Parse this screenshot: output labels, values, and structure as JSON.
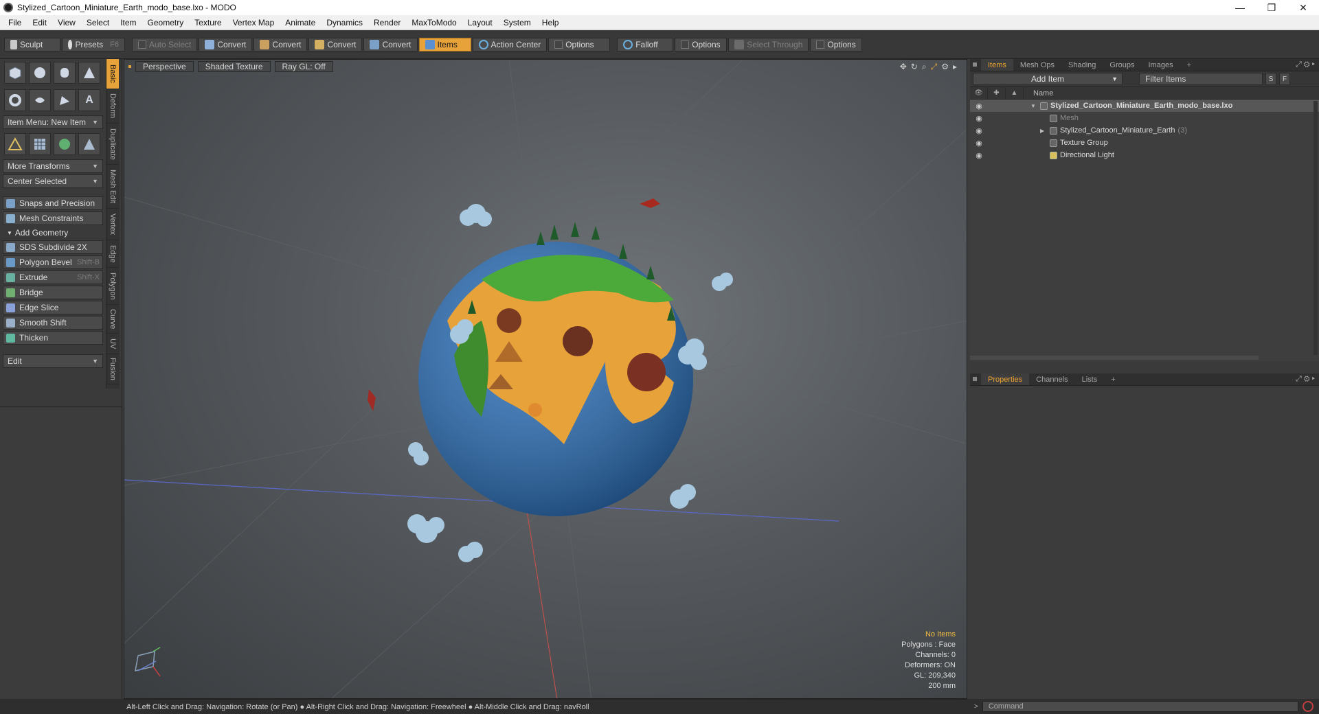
{
  "window": {
    "title": "Stylized_Cartoon_Miniature_Earth_modo_base.lxo - MODO",
    "minimize": "—",
    "restore": "❐",
    "close": "✕"
  },
  "menu": [
    "File",
    "Edit",
    "View",
    "Select",
    "Item",
    "Geometry",
    "Texture",
    "Vertex Map",
    "Animate",
    "Dynamics",
    "Render",
    "MaxToModo",
    "Layout",
    "System",
    "Help"
  ],
  "toolbar": {
    "sculpt": "Sculpt",
    "presets": "Presets",
    "presets_key": "F6",
    "auto_select": "Auto Select",
    "convert": "Convert",
    "items": "Items",
    "action_center": "Action Center",
    "options": "Options",
    "falloff": "Falloff",
    "select_through": "Select Through"
  },
  "left": {
    "item_menu": "Item Menu: New Item",
    "more_transforms": "More Transforms",
    "center_selected": "Center Selected",
    "snaps": "Snaps and Precision",
    "mesh_constraints": "Mesh Constraints",
    "add_geometry": "Add Geometry",
    "tools": [
      {
        "label": "SDS Subdivide 2X",
        "key": ""
      },
      {
        "label": "Polygon Bevel",
        "key": "Shift-B"
      },
      {
        "label": "Extrude",
        "key": "Shift-X"
      },
      {
        "label": "Bridge",
        "key": ""
      },
      {
        "label": "Edge Slice",
        "key": ""
      },
      {
        "label": "Smooth Shift",
        "key": ""
      },
      {
        "label": "Thicken",
        "key": ""
      }
    ],
    "edit": "Edit",
    "vtabs": [
      "Basic",
      "Deform",
      "Duplicate",
      "Mesh Edit",
      "Vertex",
      "Edge",
      "Polygon",
      "Curve",
      "UV",
      "Fusion"
    ]
  },
  "viewport": {
    "view": "Perspective",
    "shading": "Shaded Texture",
    "raygl": "Ray GL: Off",
    "hud": {
      "items": "No Items",
      "polygons": "Polygons : Face",
      "channels": "Channels: 0",
      "deformers": "Deformers: ON",
      "gl": "GL: 209,340",
      "scale": "200 mm"
    }
  },
  "status": "Alt-Left Click and Drag: Navigation: Rotate (or Pan) ● Alt-Right Click and Drag: Navigation: Freewheel ● Alt-Middle Click and Drag: navRoll",
  "items_panel": {
    "tabs": [
      "Items",
      "Mesh Ops",
      "Shading",
      "Groups",
      "Images"
    ],
    "add_item": "Add Item",
    "filter": "Filter Items",
    "s": "S",
    "f": "F",
    "col_name": "Name",
    "rows": [
      {
        "label": "Stylized_Cartoon_Miniature_Earth_modo_base.lxo",
        "count": ""
      },
      {
        "label": "Mesh",
        "count": ""
      },
      {
        "label": "Stylized_Cartoon_Miniature_Earth",
        "count": "(3)"
      },
      {
        "label": "Texture Group",
        "count": ""
      },
      {
        "label": "Directional Light",
        "count": ""
      }
    ]
  },
  "props_panel": {
    "tabs": [
      "Properties",
      "Channels",
      "Lists"
    ]
  },
  "command": {
    "placeholder": "Command"
  },
  "colors": {
    "accent": "#e8a23a",
    "viewport": "#55595d",
    "panel": "#3a3a3a"
  }
}
